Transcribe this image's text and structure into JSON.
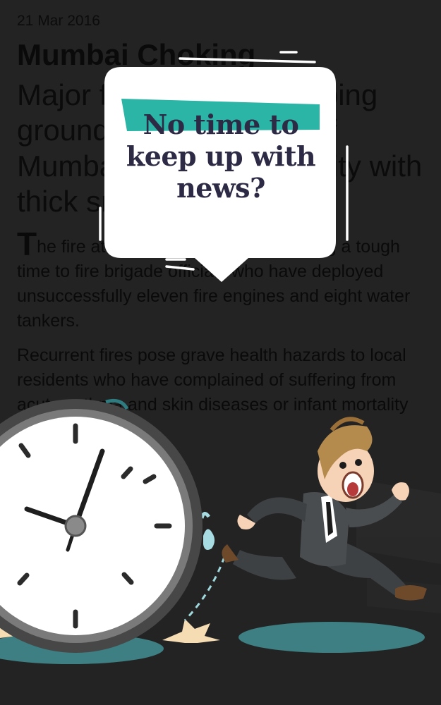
{
  "article": {
    "date": "21 Mar 2016",
    "headline": "Mumbai Choking",
    "subhead": "Major fire rages at dumping ground in the suburbs of Mumbai, engulfing the city with thick smoke",
    "p1_dropcap": "T",
    "p1_rest": "he fire at city's garbage dump is giving a tough time to fire brigade officials who have deployed unsuccessfully eleven fire engines and eight water tankers.",
    "p2": "Recurrent fires pose grave health hazards to local residents who have complained of suffering from acute asthma and skin diseases or infant mortality rates."
  },
  "bubble": {
    "line1": "No time to",
    "line2": "keep up with",
    "line3": "news?",
    "text_color": "#2c2a45",
    "accent_color": "#2ab5a6"
  },
  "illustration": {
    "icons": [
      "stopwatch-icon",
      "running-businessman-icon"
    ],
    "colors": {
      "clock_rim": "#474747",
      "clock_face": "#ffffff",
      "suit": "#4a4d50",
      "shadow": "#3d7f82"
    }
  }
}
